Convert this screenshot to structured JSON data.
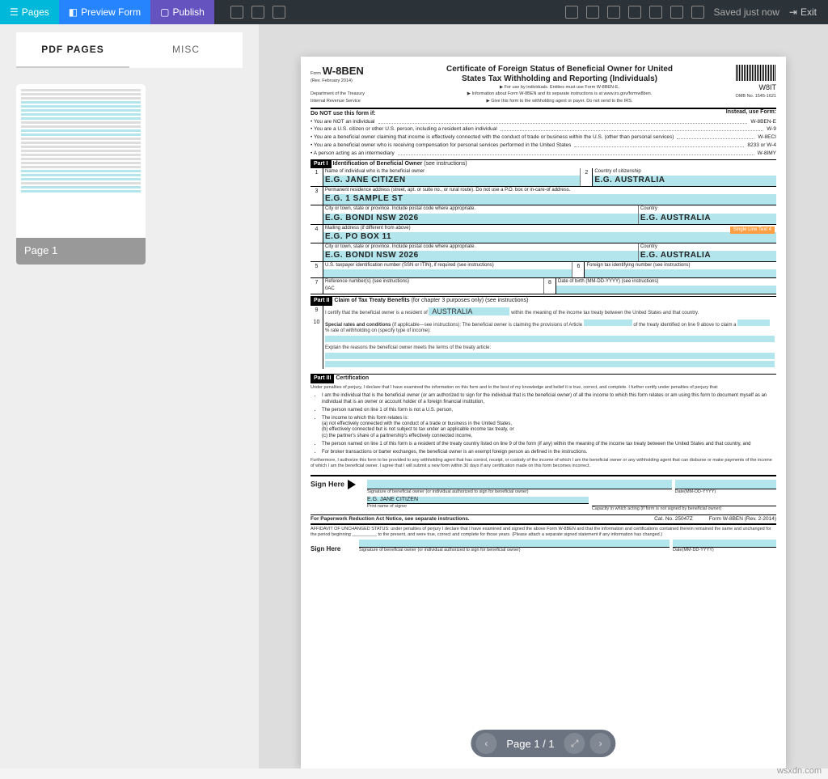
{
  "topbar": {
    "pages": "Pages",
    "preview": "Preview Form",
    "publish": "Publish",
    "saved": "Saved just now",
    "exit": "Exit"
  },
  "side": {
    "tab_pdf": "PDF PAGES",
    "tab_misc": "MISC",
    "thumb_label": "Page 1"
  },
  "pager": {
    "text": "Page 1 / 1"
  },
  "watermark": "wsxdn.com",
  "form": {
    "form_word": "Form",
    "form_code": "W-8BEN",
    "rev": "(Rev. February 2014)",
    "dept": "Department of the Treasury",
    "irs": "Internal Revenue Service",
    "title1": "Certificate of Foreign Status of Beneficial Owner for United",
    "title2": "States Tax Withholding and Reporting (Individuals)",
    "b1": "▶ For use by individuals. Entities must use Form W-8BEN-E.",
    "b2": "▶ Information about Form W-8BEN and its separate instructions is at www.irs.gov/formw8ben.",
    "b3": "▶ Give this form to the withholding agent or payer. Do not send to the IRS.",
    "w8it": "W8IT",
    "omb": "OMB No. 1545-1621",
    "donot": "Do NOT use this form if:",
    "instead": "Instead, use Form:",
    "dn1": "• You are NOT an individual",
    "dn1r": "W-8BEN-E",
    "dn2": "• You are a U.S. citizen or other U.S. person, including a resident alien individual",
    "dn2r": "W-9",
    "dn3": "• You are a beneficial owner claiming that income is effectively connected with the conduct of trade or business within the U.S. (other than personal services)",
    "dn3r": "W-8ECI",
    "dn4": "• You are a beneficial owner who is receiving compensation for personal services performed in the United States",
    "dn4r": "8233 or W-4",
    "dn5": "• A person acting as an intermediary",
    "dn5r": "W-8IMY",
    "part1": "Part I",
    "part1t": "Identification of Beneficial Owner",
    "seeinst": "(see instructions)",
    "f1n": "1",
    "f1l": "Name of individual who is the beneficial owner",
    "f1v": "E.G. JANE CITIZEN",
    "f2n": "2",
    "f2l": "Country of citizenship",
    "f2v": "E.G. AUSTRALIA",
    "f3n": "3",
    "f3l": "Permanent residence address (street, apt. or suite no., or rural route). Do not use a P.O. box or in-care-of address.",
    "f3v": "E.G. 1 SAMPLE ST",
    "f3cl": "City or town, state or province. Include postal code where appropriate.",
    "f3cv": "E.G. BONDI NSW 2026",
    "f3ctl": "Country",
    "f3ctv": "E.G. AUSTRALIA",
    "f4n": "4",
    "f4l": "Mailing address (if different from above)",
    "f4v": "E.G. PO BOX 11",
    "orange_tag": "Single Line Text 4",
    "f4cl": "City or town, state or province. Include postal code where appropriate.",
    "f4cv": "E.G. BONDI NSW 2026",
    "f4ctl": "Country",
    "f4ctv": "E.G. AUSTRALIA",
    "f5n": "5",
    "f5l": "U.S. taxpayer identification number (SSN or ITIN), if required (see instructions)",
    "f6n": "6",
    "f6l": "Foreign tax identifying number (see instructions)",
    "f7n": "7",
    "f7l": "Reference number(s) (see instructions)",
    "f7bl": "0AC",
    "f8n": "8",
    "f8l": "Date of birth (MM-DD-YYYY) (see instructions)",
    "part2": "Part II",
    "part2t": "Claim of Tax Treaty Benefits",
    "part2s": "(for chapter 3 purposes only) (see instructions)",
    "f9n": "9",
    "f9a": "I certify that the beneficial owner is a resident of",
    "f9v": "AUSTRALIA",
    "f9b": "within the meaning of the income tax treaty between the United States and that country.",
    "f10n": "10",
    "f10a": "Special rates and conditions",
    "f10b": "(if applicable—see instructions): The beneficial owner is claiming the provisions of Article",
    "f10c": "of the treaty identified on line 9 above to claim a",
    "f10d": "% rate of withholding on (specify type of income):",
    "f10e": "Explain the reasons the beneficial owner meets the terms of the treaty article:",
    "part3": "Part III",
    "part3t": "Certification",
    "cert_intro": "Under penalties of perjury, I declare that I have examined the information on this form and to the best of my knowledge and belief it is true, correct, and complete. I further certify under penalties of perjury that:",
    "c1": "I am the individual that is the beneficial owner (or am authorized to sign for the individual that is the beneficial owner) of all the income to which this form relates or am using this form to document myself as an individual that is an owner or account holder of a foreign financial institution,",
    "c2": "The person named on line 1 of this form is not a U.S. person,",
    "c3": "The income to which this form relates is:",
    "c3a": "(a) not effectively connected with the conduct of a trade or business in the United States,",
    "c3b": "(b) effectively connected but is not subject to tax under an applicable income tax treaty, or",
    "c3c": "(c) the partner's share of a partnership's effectively connected income,",
    "c4": "The person named on line 1 of this form is a resident of the treaty country listed on line 9 of the form (if any) within the meaning of the income tax treaty between the United States and that country, and",
    "c5": "For broker transactions or barter exchanges, the beneficial owner is an exempt foreign person as defined in the instructions.",
    "c6": "Furthermore, I authorize this form to be provided to any withholding agent that has control, receipt, or custody of the income of which I am the beneficial owner or any withholding agent that can disburse or make payments of the income of which I am the beneficial owner. I agree that I will submit a new form within 30 days if any certification made on this form becomes incorrect.",
    "sign_here": "Sign Here",
    "sig_l": "Signature of beneficial owner (or individual authorized to sign for beneficial owner)",
    "sig_d": "Date(MM-DD-YYYY)",
    "print_v": "E.G. JANE CITIZEN",
    "print_l": "Print name of signer",
    "cap_l": "Capacity in which acting (if form is not signed by beneficial owner)",
    "paperwork": "For Paperwork Reduction Act Notice, see separate instructions.",
    "cat": "Cat. No. 25047Z",
    "formfoot": "Form W-8BEN (Rev. 2-2014)",
    "aff": "AFFIDAVIT OF UNCHANGED STATUS: under penalties of perjury I declare that I have examined and signed the above Form W-8BEN and that the information and certifications contained therein remained the same and unchanged for the period beginning __________ to the present, and were true, correct and complete for those years. (Please attach a separate signed statement if any information has changed.)",
    "sign_here2": "Sign Here",
    "sig2_l": "Signature of beneficial owner (or individual authorized to sign for beneficial owner)",
    "sig2_d": "Date(MM-DD-YYYY)"
  }
}
